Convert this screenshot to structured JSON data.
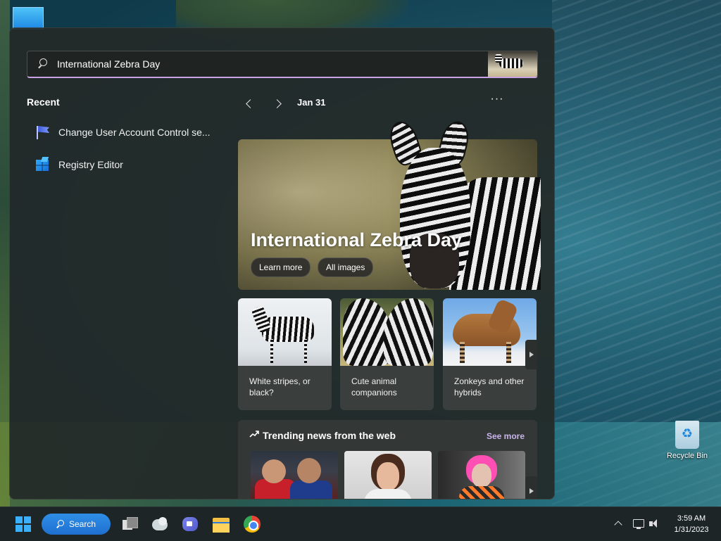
{
  "search": {
    "query": "International Zebra Day"
  },
  "recent": {
    "title": "Recent",
    "items": [
      {
        "label": "Change User Account Control se...",
        "icon": "uac-flag-icon"
      },
      {
        "label": "Registry Editor",
        "icon": "registry-editor-icon"
      }
    ]
  },
  "highlights": {
    "date": "Jan 31",
    "more_label": "···",
    "hero": {
      "title": "International Zebra Day",
      "buttons": [
        "Learn more",
        "All images"
      ]
    },
    "cards": [
      {
        "caption": "White stripes, or black?"
      },
      {
        "caption": "Cute animal companions"
      },
      {
        "caption": "Zonkeys and other hybrids"
      }
    ]
  },
  "trending": {
    "title": "Trending news from the web",
    "see_more": "See more"
  },
  "desktop": {
    "recycle_bin_label": "Recycle Bin"
  },
  "taskbar": {
    "search_label": "Search",
    "time": "3:59 AM",
    "date": "1/31/2023"
  },
  "colors": {
    "accent": "#c9a2e6",
    "taskbar_search": "#2f8fe6",
    "windows_logo": "#3ab0ff"
  }
}
